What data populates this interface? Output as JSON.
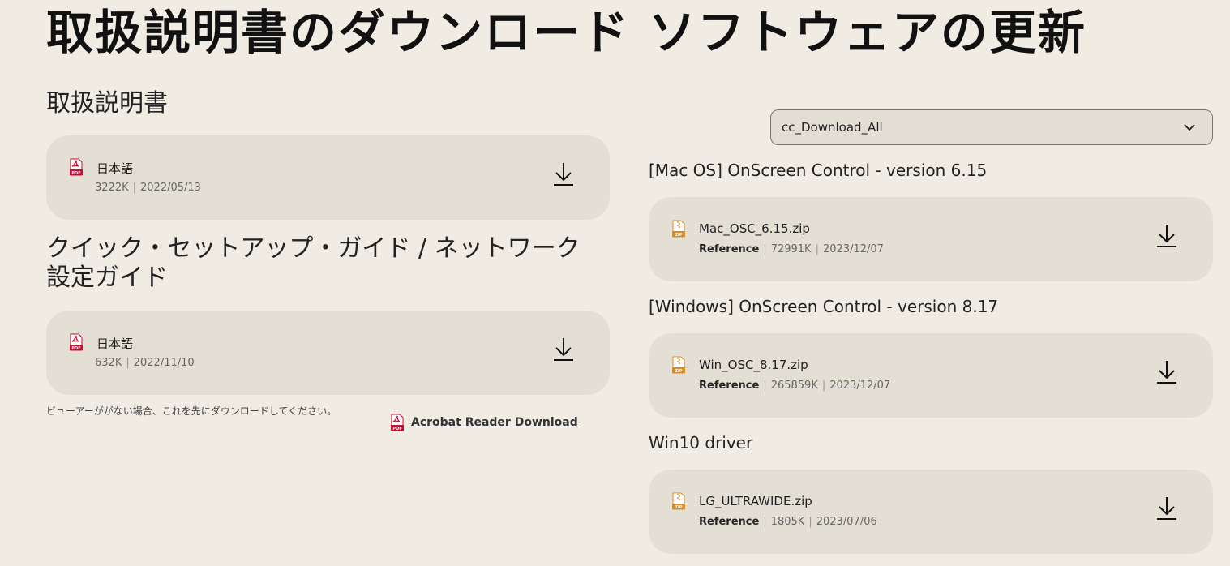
{
  "manuals": {
    "heading": "取扱説明書のダウンロード",
    "sections": [
      {
        "title": "取扱説明書",
        "file": {
          "name": "日本語",
          "size": "3222K",
          "date": "2022/05/13",
          "icon": "pdf-icon"
        }
      },
      {
        "title": "クイック・セットアップ・ガイド / ネットワーク設定ガイド",
        "file": {
          "name": "日本語",
          "size": "632K",
          "date": "2022/11/10",
          "icon": "pdf-icon"
        }
      }
    ],
    "viewer_note": "ビューアーががない場合、これを先にダウンロードしてください。",
    "acrobat_link": "Acrobat Reader Download"
  },
  "software": {
    "heading": "ソフトウェアの更新",
    "filter": {
      "selected": "cc_Download_All"
    },
    "groups": [
      {
        "title": "[Mac OS] OnScreen Control - version 6.15",
        "file": {
          "name": "Mac_OSC_6.15.zip",
          "tag": "Reference",
          "size": "72991K",
          "date": "2023/12/07",
          "icon": "zip-icon"
        }
      },
      {
        "title": "[Windows] OnScreen Control - version 8.17",
        "file": {
          "name": "Win_OSC_8.17.zip",
          "tag": "Reference",
          "size": "265859K",
          "date": "2023/12/07",
          "icon": "zip-icon"
        }
      },
      {
        "title": "Win10 driver",
        "file": {
          "name": "LG_ULTRAWIDE.zip",
          "tag": "Reference",
          "size": "1805K",
          "date": "2023/07/06",
          "icon": "zip-icon"
        }
      }
    ]
  },
  "colors": {
    "background": "#f0ebe3",
    "card": "#e4dfd4",
    "pdf_red": "#c8102e",
    "zip_orange": "#d98b1f"
  }
}
